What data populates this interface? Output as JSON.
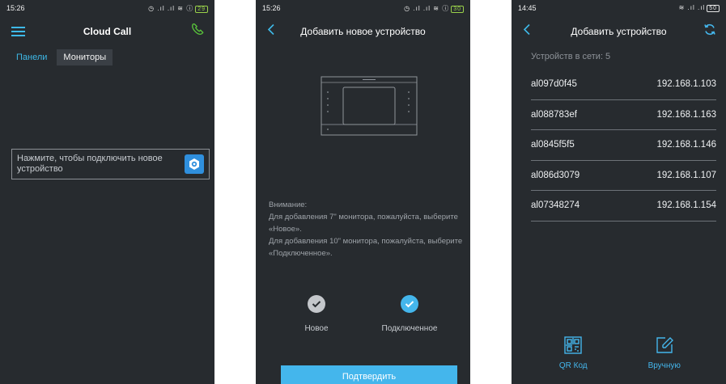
{
  "phone1": {
    "status": {
      "time": "15:26",
      "icons": "◷ .ıl .ıl ≋ ⓘ",
      "battery": "29"
    },
    "title": "Cloud Call",
    "tabs": [
      {
        "label": "Панели",
        "active": false
      },
      {
        "label": "Мониторы",
        "active": true
      }
    ],
    "connect_prompt": "Нажмите, чтобы подключить новое устройство"
  },
  "phone2": {
    "status": {
      "time": "15:26",
      "icons": "◷ .ıl .ıl ≋ ⓘ",
      "battery": "30"
    },
    "title": "Добавить новое устройство",
    "notice_lines": [
      "Внимание:",
      "Для добавления 7\" монитора, пожалуйста, выберите «Новое».",
      "Для добавления 10\" монитора, пожалуйста, выберите «Подключенное»."
    ],
    "options": [
      {
        "label": "Новое",
        "selected": false
      },
      {
        "label": "Подключенное",
        "selected": true
      }
    ],
    "confirm_label": "Подтвердить"
  },
  "phone3": {
    "status": {
      "time": "14:45",
      "icons": "≋ .ıl .ıl",
      "battery": "50"
    },
    "title": "Добавить устройство",
    "count_label": "Устройств в сети: 5",
    "devices": [
      {
        "id": "al097d0f45",
        "ip": "192.168.1.103"
      },
      {
        "id": "al088783ef",
        "ip": "192.168.1.163"
      },
      {
        "id": "al0845f5f5",
        "ip": "192.168.1.146"
      },
      {
        "id": "al086d3079",
        "ip": "192.168.1.107"
      },
      {
        "id": "al07348274",
        "ip": "192.168.1.154"
      }
    ],
    "actions": [
      {
        "label": "QR Код",
        "icon": "qr-code-icon"
      },
      {
        "label": "Вручную",
        "icon": "edit-icon"
      }
    ]
  },
  "colors": {
    "background": "#272b2f",
    "accent": "#44b6ec",
    "call": "#59c43b",
    "muted": "#8d9298"
  }
}
